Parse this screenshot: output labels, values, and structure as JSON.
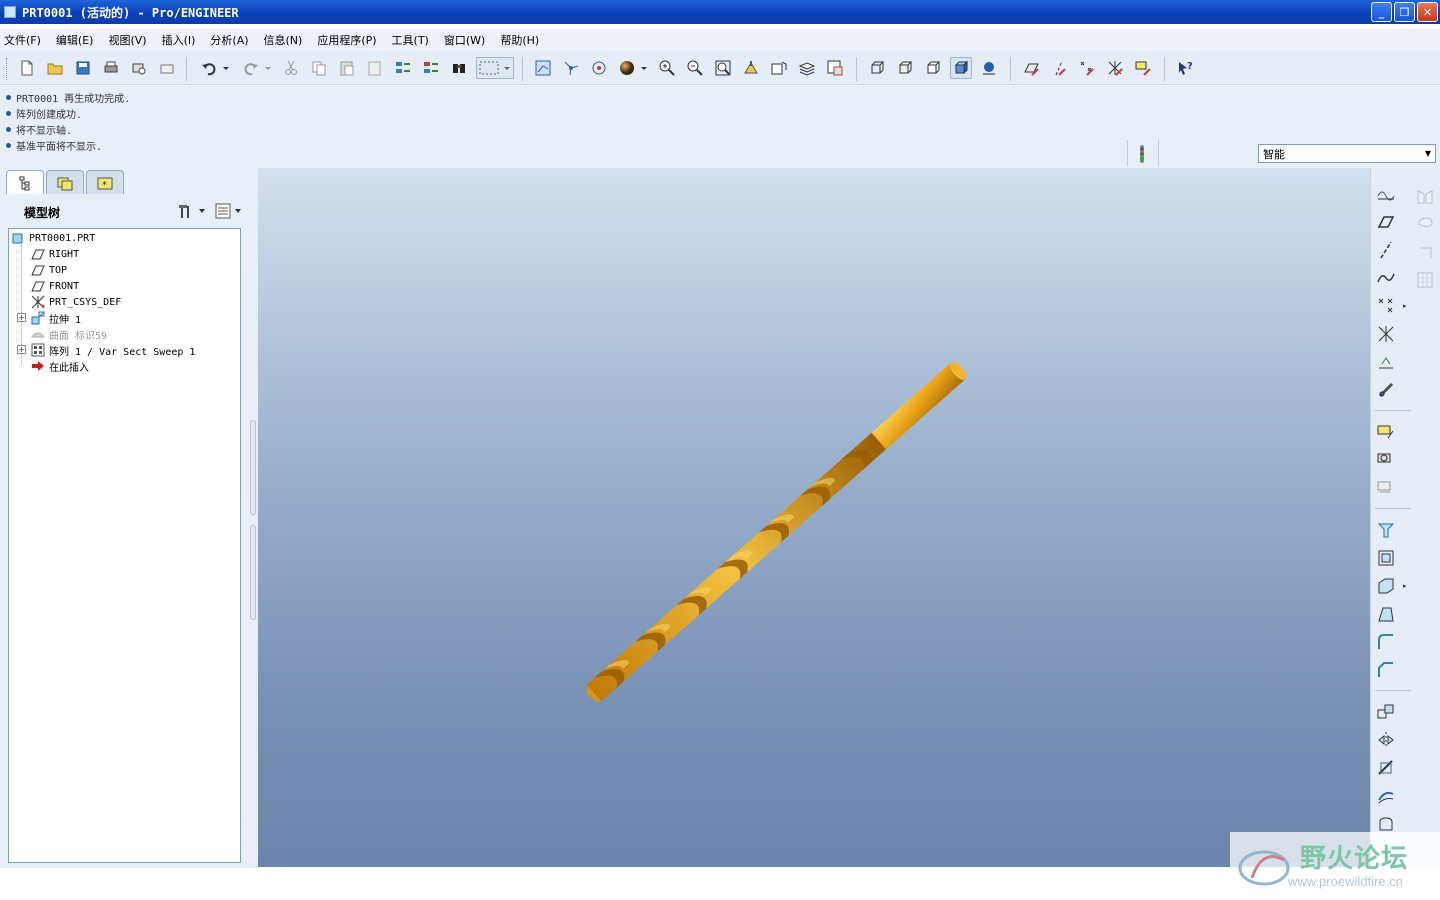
{
  "window": {
    "title": "PRT0001 (活动的) - Pro/ENGINEER",
    "minimize": "_",
    "restore": "❐",
    "close": "✕"
  },
  "menu": [
    "文件(F)",
    "编辑(E)",
    "视图(V)",
    "插入(I)",
    "分析(A)",
    "信息(N)",
    "应用程序(P)",
    "工具(T)",
    "窗口(W)",
    "帮助(H)"
  ],
  "messages": [
    "PRT0001 再生成功完成.",
    "阵列创建成功.",
    "将不显示轴.",
    "基准平面将不显示."
  ],
  "filter": {
    "value": "智能"
  },
  "navigator": {
    "title": "模型树",
    "tabs": [
      "model-tree-tab",
      "layers-tab",
      "favorites-tab"
    ]
  },
  "tree": [
    {
      "label": "PRT0001.PRT",
      "icon": "part-icon"
    },
    {
      "label": "RIGHT",
      "icon": "datum-plane-icon"
    },
    {
      "label": "TOP",
      "icon": "datum-plane-icon"
    },
    {
      "label": "FRONT",
      "icon": "datum-plane-icon"
    },
    {
      "label": "PRT_CSYS_DEF",
      "icon": "coordinate-system-icon"
    },
    {
      "label": "拉伸 1",
      "icon": "extrude-icon"
    },
    {
      "label": "曲面 标识59",
      "icon": "surface-icon"
    },
    {
      "label": "阵列 1 / Var Sect Sweep 1",
      "icon": "pattern-icon"
    },
    {
      "label": "在此插入",
      "icon": "insert-here-arrow-icon"
    }
  ],
  "model": {
    "name": "twist drill",
    "color": "#e8a315"
  },
  "watermark": {
    "title": "野火论坛",
    "url": "www.proewildfire.cn"
  }
}
